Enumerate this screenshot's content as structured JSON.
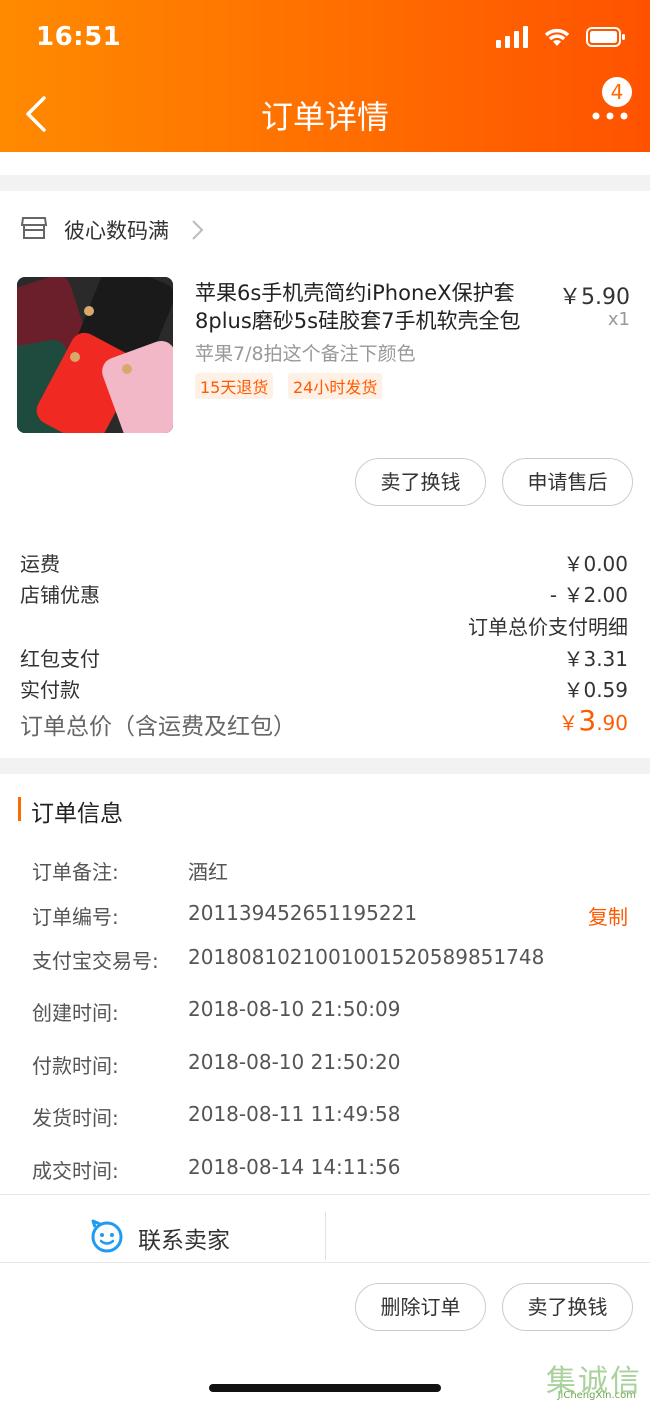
{
  "status_bar": {
    "time": "16:51"
  },
  "nav": {
    "title": "订单详情",
    "badge_count": "4"
  },
  "shop": {
    "name": "彼心数码满"
  },
  "product": {
    "title": "苹果6s手机壳简约iPhoneX保护套8plus磨砂5s硅胶套7手机软壳全包",
    "price": "￥5.90",
    "quantity": "x1",
    "sku_note": "苹果7/8拍这个备注下颜色",
    "tags": [
      "15天退货",
      "24小时发货"
    ]
  },
  "product_actions": {
    "sell": "卖了换钱",
    "after_sale": "申请售后"
  },
  "fees": {
    "shipping_label": "运费",
    "shipping_value": "￥0.00",
    "discount_label": "店铺优惠",
    "discount_value": "- ￥2.00",
    "detail_link": "订单总价支付明细",
    "redpacket_label": "红包支付",
    "redpacket_value": "￥3.31",
    "paid_label": "实付款",
    "paid_value": "￥0.59",
    "total_label": "订单总价（含运费及红包）",
    "total_currency": "￥",
    "total_int": "3",
    "total_dec": ".90"
  },
  "order_info": {
    "title": "订单信息",
    "rows": [
      {
        "label": "订单备注:",
        "value": "酒红"
      },
      {
        "label": "订单编号:",
        "value": "201139452651195221"
      },
      {
        "label": "支付宝交易号:",
        "value": "2018081021001001520589851748"
      },
      {
        "label": "创建时间:",
        "value": "2018-08-10 21:50:09"
      },
      {
        "label": "付款时间:",
        "value": "2018-08-10 21:50:20"
      },
      {
        "label": "发货时间:",
        "value": "2018-08-11 11:49:58"
      },
      {
        "label": "成交时间:",
        "value": "2018-08-14 14:11:56"
      }
    ],
    "copy_label": "复制"
  },
  "contact": {
    "label": "联系卖家"
  },
  "bottom_actions": {
    "delete": "删除订单",
    "sell": "卖了换钱"
  },
  "watermark": {
    "text": "集诚信",
    "sub": "JiChengXin.com"
  },
  "colors": {
    "accent": "#ff6a00",
    "header_start": "#ff8a00",
    "header_end": "#ff5200",
    "contact_blue": "#1f9cf0"
  }
}
